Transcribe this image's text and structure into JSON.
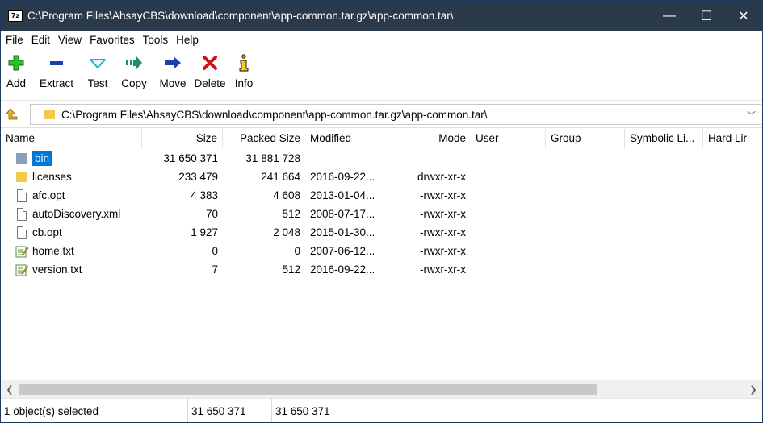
{
  "window": {
    "title": "C:\\Program Files\\AhsayCBS\\download\\component\\app-common.tar.gz\\app-common.tar\\",
    "app_icon_text": "7z",
    "minimize_glyph": "—",
    "maximize_glyph": "☐",
    "close_glyph": "✕"
  },
  "menu": [
    "File",
    "Edit",
    "View",
    "Favorites",
    "Tools",
    "Help"
  ],
  "toolbar": {
    "add": "Add",
    "extract": "Extract",
    "test": "Test",
    "copy": "Copy",
    "move": "Move",
    "delete": "Delete",
    "info": "Info"
  },
  "address": {
    "path": "C:\\Program Files\\AhsayCBS\\download\\component\\app-common.tar.gz\\app-common.tar\\",
    "chevron": "﹀"
  },
  "columns": {
    "name": "Name",
    "size": "Size",
    "packed": "Packed Size",
    "modified": "Modified",
    "mode": "Mode",
    "user": "User",
    "group": "Group",
    "symlink": "Symbolic Li...",
    "hardlink": "Hard Lir"
  },
  "files": [
    {
      "name": "bin",
      "size": "31 650 371",
      "packed": "31 881 728",
      "modified": "",
      "mode": "",
      "type": "folder",
      "selected": true
    },
    {
      "name": "licenses",
      "size": "233 479",
      "packed": "241 664",
      "modified": "2016-09-22...",
      "mode": "drwxr-xr-x",
      "type": "folder",
      "selected": false
    },
    {
      "name": "afc.opt",
      "size": "4 383",
      "packed": "4 608",
      "modified": "2013-01-04...",
      "mode": "-rwxr-xr-x",
      "type": "file",
      "selected": false
    },
    {
      "name": "autoDiscovery.xml",
      "size": "70",
      "packed": "512",
      "modified": "2008-07-17...",
      "mode": "-rwxr-xr-x",
      "type": "file",
      "selected": false
    },
    {
      "name": "cb.opt",
      "size": "1 927",
      "packed": "2 048",
      "modified": "2015-01-30...",
      "mode": "-rwxr-xr-x",
      "type": "file",
      "selected": false
    },
    {
      "name": "home.txt",
      "size": "0",
      "packed": "0",
      "modified": "2007-06-12...",
      "mode": "-rwxr-xr-x",
      "type": "txt",
      "selected": false
    },
    {
      "name": "version.txt",
      "size": "7",
      "packed": "512",
      "modified": "2016-09-22...",
      "mode": "-rwxr-xr-x",
      "type": "txt",
      "selected": false
    }
  ],
  "scroll": {
    "left_arrow": "❮",
    "right_arrow": "❯"
  },
  "status": {
    "selection": "1 object(s) selected",
    "size": "31 650 371",
    "packed": "31 650 371"
  },
  "colors": {
    "titlebar": "#2b3a4a",
    "selection": "#0078d7",
    "folder": "#f2c94c",
    "add_icon": "#2dc02d",
    "extract_icon": "#1a3fb5",
    "test_icon": "#20b0c8",
    "copy_icon": "#1d8f6e",
    "move_icon": "#1a3fb5",
    "delete_icon": "#d0101a"
  }
}
